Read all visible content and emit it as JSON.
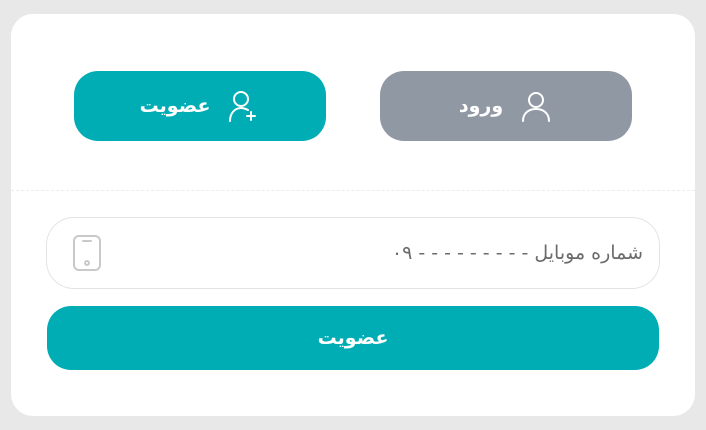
{
  "tabs": {
    "login": {
      "label": "ورود",
      "icon": "user-icon",
      "color": "#8f98a3"
    },
    "register": {
      "label": "عضویت",
      "icon": "user-add-icon",
      "color": "#00adb5"
    }
  },
  "form": {
    "phone_placeholder": "شماره موبایل - - - - - - - - - ۰۹",
    "phone_value": "",
    "phone_icon": "smartphone-icon",
    "submit_label": "عضویت",
    "submit_color": "#00adb5"
  }
}
